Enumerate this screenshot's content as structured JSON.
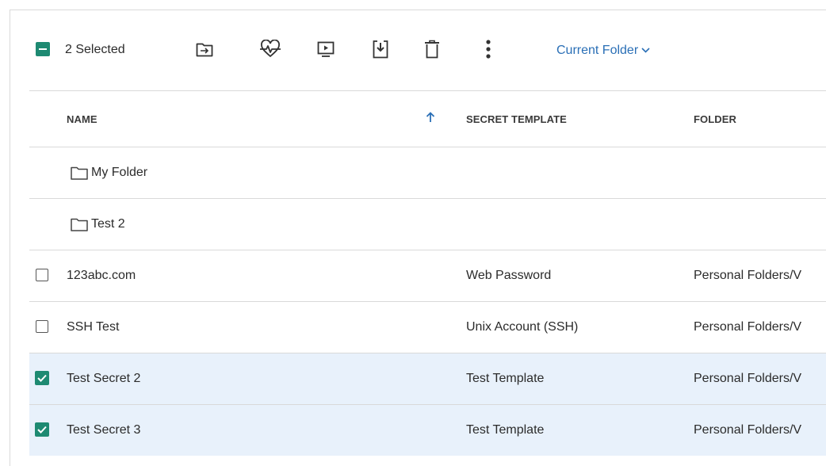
{
  "toolbar": {
    "selected_label": "2 Selected",
    "icons": [
      "move-to-folder-icon",
      "heartbeat-icon",
      "launch-icon",
      "export-icon",
      "delete-icon",
      "more-options-icon"
    ],
    "scope_label": "Current Folder"
  },
  "table": {
    "columns": [
      "NAME",
      "SECRET TEMPLATE",
      "FOLDER"
    ],
    "sort": {
      "column": "NAME",
      "direction": "ascending"
    },
    "folders": [
      {
        "name": "My Folder"
      },
      {
        "name": "Test 2"
      }
    ],
    "secrets": [
      {
        "name": "123abc.com",
        "template": "Web Password",
        "folder": "Personal Folders/V",
        "checked": false
      },
      {
        "name": "SSH Test",
        "template": "Unix Account (SSH)",
        "folder": "Personal Folders/V",
        "checked": false
      },
      {
        "name": "Test Secret 2",
        "template": "Test Template",
        "folder": "Personal Folders/V",
        "checked": true
      },
      {
        "name": "Test Secret 3",
        "template": "Test Template",
        "folder": "Personal Folders/V",
        "checked": true
      }
    ]
  },
  "colors": {
    "accent_green": "#1e8a72",
    "link_blue": "#2a6fb6",
    "selected_row": "#e8f1fb"
  }
}
